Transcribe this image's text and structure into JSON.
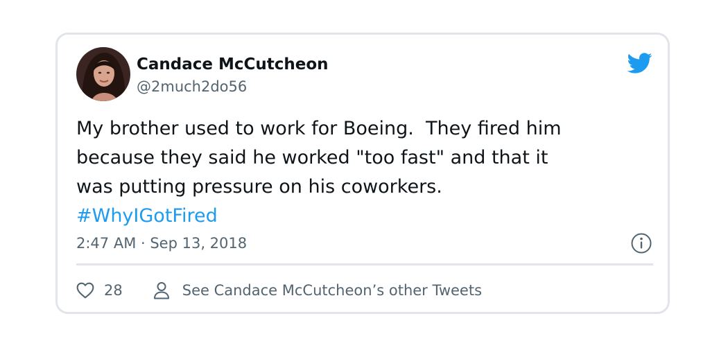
{
  "tweet": {
    "display_name": "Candace McCutcheon",
    "handle": "@2much2do56",
    "text_lines": [
      "My brother used to work for Boeing.  They fired him",
      "because they said he worked \"too fast\" and that it",
      "was putting pressure on his coworkers."
    ],
    "hashtag": "#WhyIGotFired",
    "timestamp": "2:47 AM · Sep 13, 2018",
    "like_count": "28",
    "profile_link_label": "See Candace McCutcheon’s other Tweets"
  },
  "icons": {
    "logo": "twitter-bird-icon",
    "info": "info-icon",
    "like": "heart-icon",
    "profile": "person-icon"
  },
  "colors": {
    "text": "#0f1419",
    "secondary": "#536471",
    "accent": "#1d9bf0",
    "border": "#e1e5e9"
  }
}
